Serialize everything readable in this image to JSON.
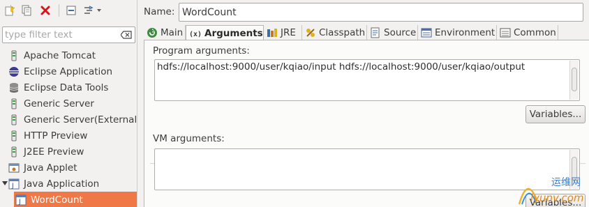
{
  "toolbar": {
    "buttons": [
      {
        "name": "new-config-button",
        "icon": "new-launch-config-icon"
      },
      {
        "name": "duplicate-button",
        "icon": "duplicate-icon"
      },
      {
        "name": "delete-button",
        "icon": "delete-icon"
      },
      {
        "name": "collapse-all-button",
        "icon": "collapse-all-icon"
      },
      {
        "name": "filter-menu-button",
        "icon": "filter-dropdown-icon"
      }
    ]
  },
  "filter": {
    "placeholder": "type filter text",
    "value": ""
  },
  "tree": {
    "items": [
      {
        "label": "Apache Tomcat",
        "icon": "tomcat-icon"
      },
      {
        "label": "Eclipse Application",
        "icon": "eclipse-icon"
      },
      {
        "label": "Eclipse Data Tools",
        "icon": "database-icon"
      },
      {
        "label": "Generic Server",
        "icon": "server-icon"
      },
      {
        "label": "Generic Server(External",
        "icon": "server-icon"
      },
      {
        "label": "HTTP Preview",
        "icon": "server-icon"
      },
      {
        "label": "J2EE Preview",
        "icon": "server-icon"
      },
      {
        "label": "Java Applet",
        "icon": "applet-icon"
      },
      {
        "label": "Java Application",
        "icon": "java-app-icon",
        "expanded": true
      },
      {
        "label": "WordCount",
        "icon": "java-app-icon",
        "selected": true
      }
    ]
  },
  "config": {
    "name_label": "Name:",
    "name_value": "WordCount"
  },
  "tabs": [
    {
      "label": "Main",
      "icon": "main-tab-icon"
    },
    {
      "label": "Arguments",
      "icon": "arguments-tab-icon",
      "active": true
    },
    {
      "label": "JRE",
      "icon": "jre-tab-icon"
    },
    {
      "label": "Classpath",
      "icon": "classpath-tab-icon"
    },
    {
      "label": "Source",
      "icon": "source-tab-icon"
    },
    {
      "label": "Environment",
      "icon": "environment-tab-icon"
    },
    {
      "label": "Common",
      "icon": "common-tab-icon"
    }
  ],
  "arguments": {
    "program_label": "Program arguments:",
    "program_value": "hdfs://localhost:9000/user/kqiao/input  hdfs://localhost:9000/user/kqiao/output",
    "variables_button": "Variables...",
    "vm_label": "VM arguments:",
    "vm_value": "",
    "vm_variables_button": "Variables..."
  },
  "watermark": {
    "line1": "运维网",
    "line2": "iyunv.com"
  },
  "colors": {
    "accent": "#f07746",
    "background": "#f2f1f0",
    "panel": "#fbfbfa",
    "text": "#3c3c3c"
  }
}
